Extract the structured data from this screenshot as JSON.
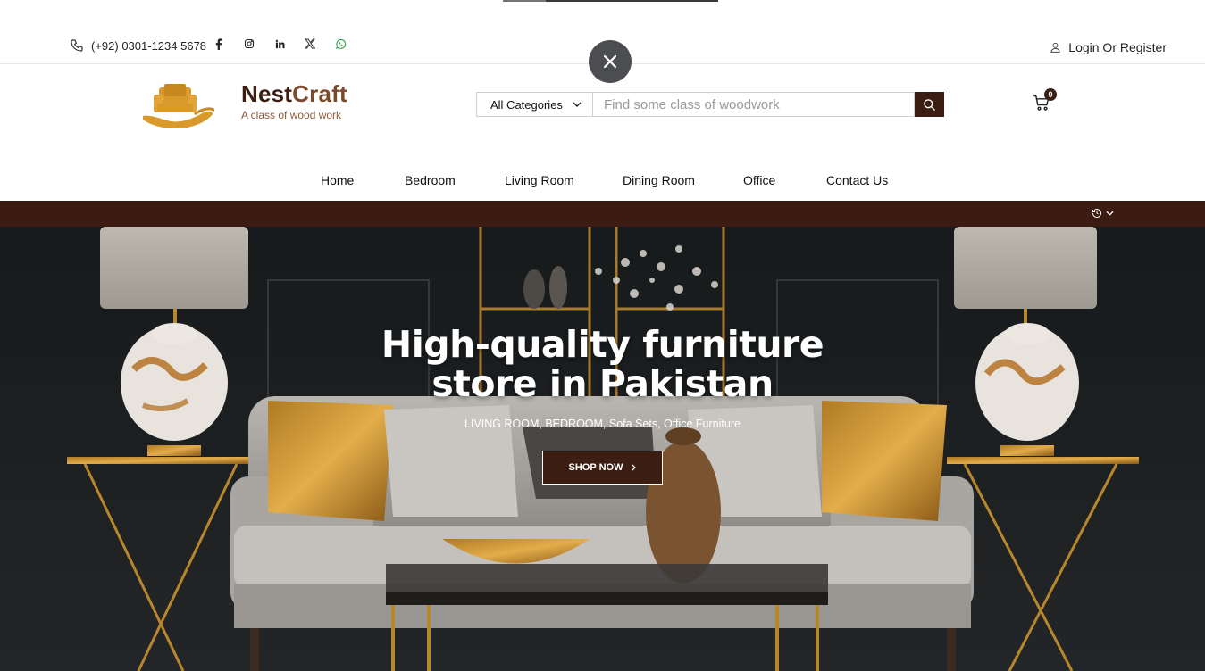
{
  "topbar": {
    "phone": "(+92) 0301-1234 5678",
    "social_icons": [
      "facebook-icon",
      "instagram-icon",
      "linkedin-icon",
      "x-twitter-icon",
      "whatsapp-icon"
    ],
    "login_label": "Login Or Register"
  },
  "brand": {
    "name_part1": "Nest",
    "name_part2": "Craft",
    "tagline": "A class of wood work"
  },
  "search": {
    "category_selected": "All Categories",
    "placeholder": "Find some class of woodwork"
  },
  "cart": {
    "count": "0"
  },
  "nav": {
    "items": [
      "Home",
      "Bedroom",
      "Living Room",
      "Dining Room",
      "Office",
      "Contact Us"
    ]
  },
  "hero": {
    "title_line1": "High-quality furniture",
    "title_line2": "store in Pakistan",
    "subtitle": "LIVING ROOM, BEDROOM, Sofa Sets, Office Furniture",
    "cta_label": "SHOP NOW"
  },
  "colors": {
    "brand_dark": "#3b1d12",
    "brand_gold": "#d99a2b",
    "close_button": "#4b4d50"
  }
}
